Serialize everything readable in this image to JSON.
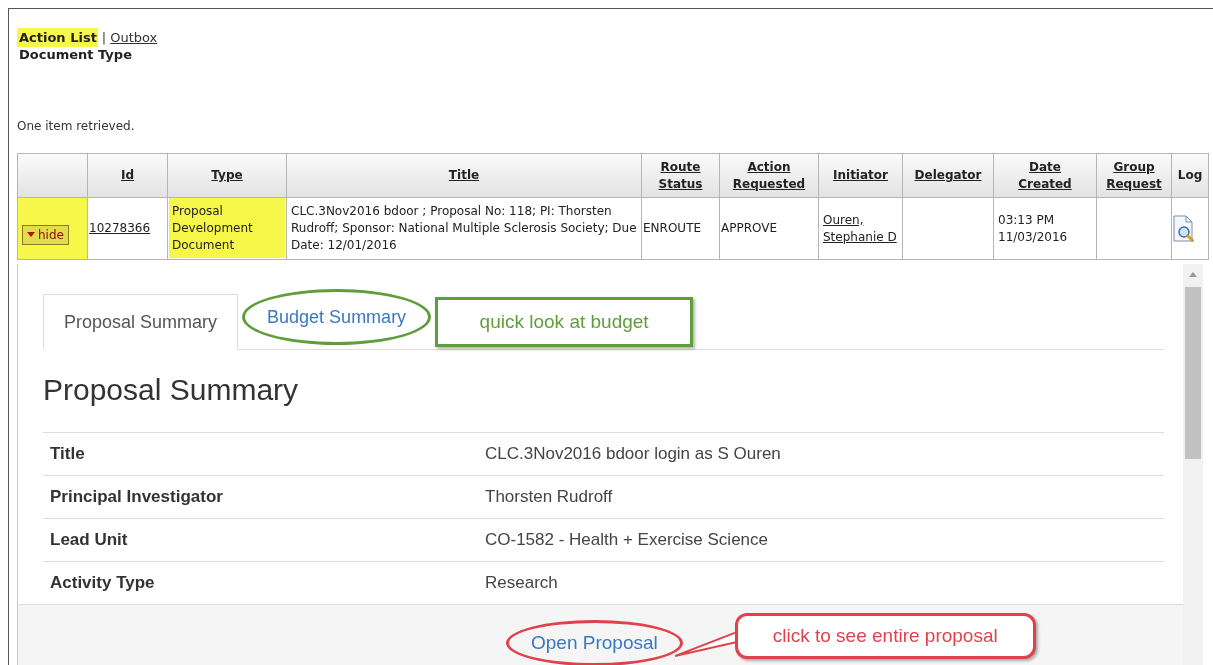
{
  "nav": {
    "items": [
      {
        "label": "Action List",
        "selected": true
      },
      {
        "label": "Outbox",
        "selected": false
      }
    ],
    "separator": "|"
  },
  "filter_label": "Document Type",
  "result_message": "One item retrieved.",
  "table": {
    "columns": [
      {
        "label": "Id",
        "sortable": true
      },
      {
        "label": "Type",
        "sortable": true
      },
      {
        "label": "Title",
        "sortable": true
      },
      {
        "label": "Route Status",
        "sortable": true
      },
      {
        "label": "Action Requested",
        "sortable": true
      },
      {
        "label": "Initiator",
        "sortable": true
      },
      {
        "label": "Delegator",
        "sortable": true
      },
      {
        "label": "Date Created",
        "sortable": true
      },
      {
        "label": "Group Request",
        "sortable": true
      },
      {
        "label": "Log",
        "sortable": false
      }
    ],
    "rows": [
      {
        "toggle": {
          "label": "hide",
          "expanded": true,
          "highlighted": true
        },
        "id": "10278366",
        "type": "Proposal Development Document",
        "type_highlighted": true,
        "title": "CLC.3Nov2016 bdoor ; Proposal No: 118; PI: Thorsten Rudroff; Sponsor: National Multiple Sclerosis Society; Due Date: 12/01/2016",
        "route_status": "ENROUTE",
        "action_requested": "APPROVE",
        "initiator": "Ouren, Stephanie D",
        "date_created": "03:13 PM 11/03/2016"
      }
    ]
  },
  "panel": {
    "tabs": [
      {
        "label": "Proposal Summary",
        "selected": true,
        "circled": false
      },
      {
        "label": "Budget Summary",
        "selected": false,
        "circled": true
      }
    ],
    "heading": "Proposal Summary",
    "fields": [
      {
        "label": "Title",
        "value": "CLC.3Nov2016 bdoor login as S Ouren"
      },
      {
        "label": "Principal Investigator",
        "value": "Thorsten Rudroff"
      },
      {
        "label": "Lead Unit",
        "value": "CO-1582 - Health + Exercise Science"
      },
      {
        "label": "Activity Type",
        "value": "Research"
      }
    ],
    "footer_link": {
      "label": "Open Proposal",
      "circled": true
    }
  },
  "annotations": [
    {
      "kind": "box",
      "text": "quick look at budget",
      "color": "#5f9e3a"
    },
    {
      "kind": "callout",
      "text": "click to see entire proposal",
      "color": "#e0424b"
    }
  ]
}
